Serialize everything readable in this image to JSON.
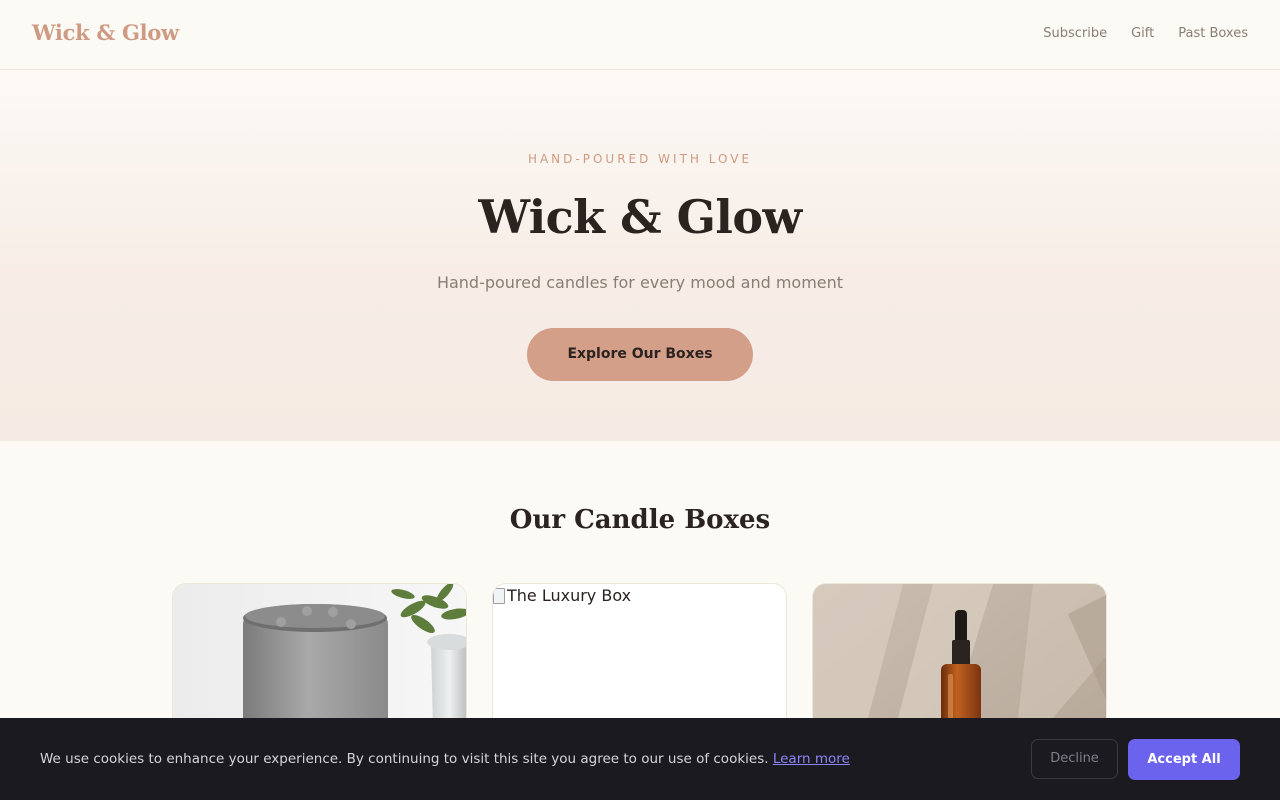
{
  "header": {
    "logo": "Wick & Glow",
    "nav": [
      {
        "label": "Subscribe"
      },
      {
        "label": "Gift"
      },
      {
        "label": "Past Boxes"
      }
    ]
  },
  "hero": {
    "eyebrow": "HAND-POURED WITH LOVE",
    "title": "Wick & Glow",
    "subtitle": "Hand-poured candles for every mood and moment",
    "cta_label": "Explore Our Boxes"
  },
  "boxes": {
    "section_title": "Our Candle Boxes",
    "cards": [
      {
        "image": "smart-speaker-and-plant-photo"
      },
      {
        "image_alt": "The Luxury Box"
      },
      {
        "image": "amber-dropper-bottle-photo"
      }
    ]
  },
  "cookie_banner": {
    "message": "We use cookies to enhance your experience. By continuing to visit this site you agree to our use of cookies.",
    "link_label": "Learn more",
    "decline_label": "Decline",
    "accept_label": "Accept All"
  },
  "colors": {
    "accent": "#cf9a83",
    "cta": "#d49f89",
    "accept": "#6b62ee",
    "banner": "#1b1a20"
  }
}
